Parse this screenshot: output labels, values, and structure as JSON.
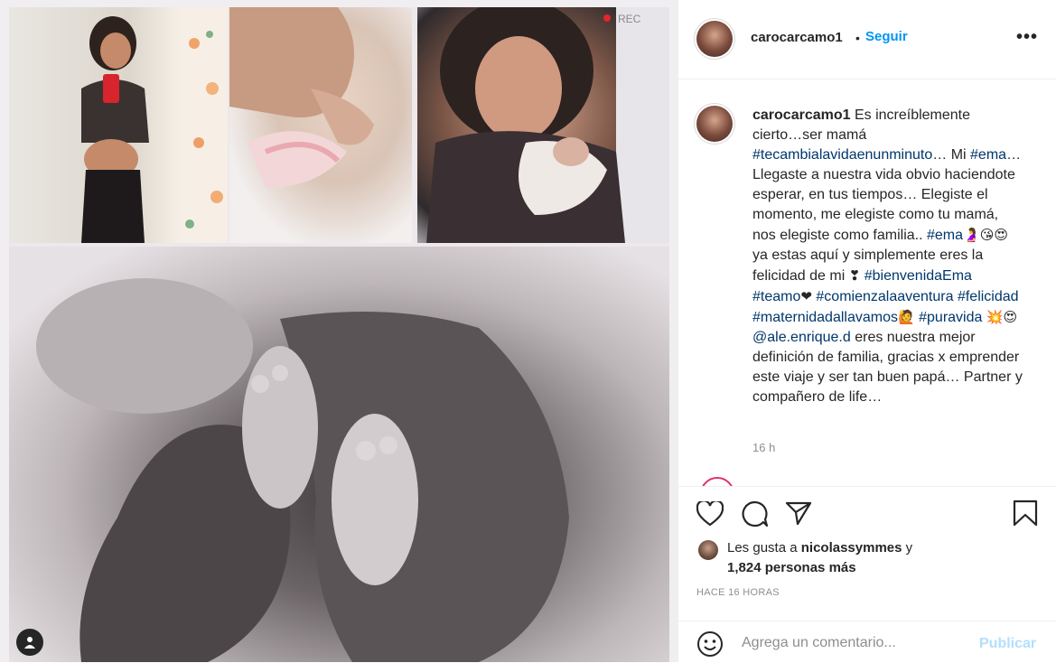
{
  "post": {
    "username": "carocarcamo1",
    "follow_label": "Seguir",
    "dot": "•",
    "more_label": "•••"
  },
  "caption": {
    "username": "carocarcamo1",
    "segments": [
      {
        "t": " Es increíblemente cierto…ser mamá "
      },
      {
        "t": "#tecambialavidaenunminuto",
        "h": true
      },
      {
        "t": "… Mi "
      },
      {
        "t": "#ema",
        "h": true
      },
      {
        "t": "… Llegaste a nuestra vida obvio haciendote esperar, en tus tiempos… Elegiste el momento, me elegiste como tu mamá, nos elegiste como familia.. "
      },
      {
        "t": "#ema",
        "h": true
      },
      {
        "t": "🤰😘😍",
        "e": true
      },
      {
        "t": " ya estas aquí y simplemente eres la felicidad de mi "
      },
      {
        "t": "❣",
        "e": true
      },
      {
        "t": " "
      },
      {
        "t": "#bienvenidaEma",
        "h": true
      },
      {
        "t": " "
      },
      {
        "t": "#teamo",
        "h": true
      },
      {
        "t": "❤",
        "e": true
      },
      {
        "t": " "
      },
      {
        "t": "#comienzalaaventura",
        "h": true
      },
      {
        "t": " "
      },
      {
        "t": "#felicidad",
        "h": true
      },
      {
        "t": " "
      },
      {
        "t": "#maternidadallavamos",
        "h": true
      },
      {
        "t": "🙋",
        "e": true
      },
      {
        "t": " "
      },
      {
        "t": "#puravida",
        "h": true
      },
      {
        "t": " "
      },
      {
        "t": "💥😍",
        "e": true
      },
      {
        "t": " "
      },
      {
        "t": "@ale.enrique.d",
        "h": true
      },
      {
        "t": " eres nuestra mejor definición de familia, gracias x emprender este viaje y ser tan buen papá… Partner y compañero de life…"
      }
    ],
    "time": "16 h"
  },
  "likes": {
    "prefix": "Les gusta a ",
    "user": "nicolassymmes",
    "suffix": " y",
    "count": "1,824 personas más"
  },
  "timestamp": "HACE 16 HORAS",
  "comment": {
    "placeholder": "Agrega un comentario...",
    "publish_label": "Publicar"
  },
  "colors": {
    "link": "#00376b",
    "follow": "#0095f6",
    "publish_disabled": "#b2dffc"
  },
  "icons": [
    "heart-icon",
    "comment-icon",
    "share-icon",
    "bookmark-icon",
    "emoji-icon",
    "user-tag-icon"
  ]
}
